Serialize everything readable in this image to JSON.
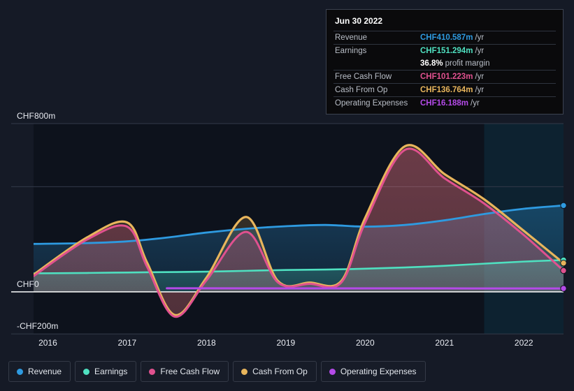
{
  "colors": {
    "revenue": "#2e9ae0",
    "earnings": "#4fe0c0",
    "free_cash_flow": "#e0518f",
    "cash_from_op": "#e8b55c",
    "operating_expenses": "#b44ae8",
    "background": "#151a26",
    "plot_background": "#0d121c",
    "forecast_band": "#0d2230",
    "gridline": "#333a49",
    "zero_line": "#ffffff",
    "axis_text": "#e9ecf2"
  },
  "tooltip": {
    "title": "Jun 30 2022",
    "rows": [
      {
        "label": "Revenue",
        "value": "CHF410.587m",
        "suffix": "/yr",
        "color_key": "revenue"
      },
      {
        "label": "Earnings",
        "value": "CHF151.294m",
        "suffix": "/yr",
        "color_key": "earnings"
      },
      {
        "label": "",
        "value": "36.8%",
        "suffix": "profit margin",
        "color_key": "margin"
      },
      {
        "label": "Free Cash Flow",
        "value": "CHF101.223m",
        "suffix": "/yr",
        "color_key": "free_cash_flow"
      },
      {
        "label": "Cash From Op",
        "value": "CHF136.764m",
        "suffix": "/yr",
        "color_key": "cash_from_op"
      },
      {
        "label": "Operating Expenses",
        "value": "CHF16.188m",
        "suffix": "/yr",
        "color_key": "operating_expenses"
      }
    ]
  },
  "legend": {
    "items": [
      {
        "label": "Revenue",
        "color_key": "revenue"
      },
      {
        "label": "Earnings",
        "color_key": "earnings"
      },
      {
        "label": "Free Cash Flow",
        "color_key": "free_cash_flow"
      },
      {
        "label": "Cash From Op",
        "color_key": "cash_from_op"
      },
      {
        "label": "Operating Expenses",
        "color_key": "operating_expenses"
      }
    ]
  },
  "chart_data": {
    "type": "area",
    "title": "",
    "xlabel": "",
    "ylabel": "",
    "currency": "CHF",
    "units": "millions",
    "ylim": [
      -200,
      800
    ],
    "y_ticks": [
      {
        "label": "CHF800m",
        "value": 800
      },
      {
        "label": "CHF0",
        "value": 0
      },
      {
        "label": "-CHF200m",
        "value": -200
      }
    ],
    "gridlines": [
      800,
      500,
      0,
      -200
    ],
    "grid": true,
    "legend_position": "bottom",
    "x_ticks": [
      "2016",
      "2017",
      "2018",
      "2019",
      "2020",
      "2021",
      "2022"
    ],
    "x_range": [
      2015.82,
      2022.5
    ],
    "forecast_start": "2021.5",
    "series": [
      {
        "name": "Revenue",
        "color_key": "revenue",
        "x": [
          2015.82,
          2016.5,
          2017.0,
          2017.5,
          2018.0,
          2018.5,
          2019.0,
          2019.5,
          2020.0,
          2020.5,
          2021.0,
          2021.5,
          2022.0,
          2022.5
        ],
        "values": [
          228,
          232,
          240,
          258,
          282,
          300,
          312,
          318,
          310,
          318,
          340,
          370,
          395,
          410.587
        ],
        "end_value": 410.587
      },
      {
        "name": "Earnings",
        "color_key": "earnings",
        "x": [
          2015.82,
          2016.5,
          2017.0,
          2017.5,
          2018.0,
          2018.5,
          2019.0,
          2019.5,
          2020.0,
          2020.5,
          2021.0,
          2021.5,
          2022.0,
          2022.5
        ],
        "values": [
          88,
          90,
          92,
          94,
          96,
          100,
          104,
          106,
          110,
          116,
          124,
          134,
          144,
          151.294
        ],
        "end_value": 151.294
      },
      {
        "name": "Free Cash Flow",
        "color_key": "free_cash_flow",
        "x": [
          2015.82,
          2016.5,
          2017.0,
          2017.25,
          2017.6,
          2018.0,
          2018.5,
          2018.9,
          2019.3,
          2019.7,
          2020.0,
          2020.5,
          2021.0,
          2021.5,
          2022.0,
          2022.5
        ],
        "values": [
          75,
          250,
          310,
          120,
          -118,
          55,
          285,
          45,
          38,
          45,
          330,
          675,
          540,
          420,
          270,
          101.223
        ],
        "end_value": 101.223
      },
      {
        "name": "Cash From Op",
        "color_key": "cash_from_op",
        "x": [
          2015.82,
          2016.5,
          2017.0,
          2017.25,
          2017.6,
          2018.0,
          2018.5,
          2018.9,
          2019.3,
          2019.7,
          2020.0,
          2020.5,
          2021.0,
          2021.5,
          2022.0,
          2022.5
        ],
        "values": [
          82,
          260,
          330,
          140,
          -110,
          68,
          356,
          52,
          44,
          52,
          352,
          692,
          560,
          440,
          290,
          136.764
        ],
        "end_value": 136.764
      },
      {
        "name": "Operating Expenses",
        "color_key": "operating_expenses",
        "x": [
          2017.5,
          2018.0,
          2019.0,
          2020.0,
          2021.0,
          2022.0,
          2022.5
        ],
        "values": [
          17,
          17,
          16.5,
          16.5,
          16.4,
          16.3,
          16.188
        ],
        "end_value": 16.188
      }
    ]
  }
}
